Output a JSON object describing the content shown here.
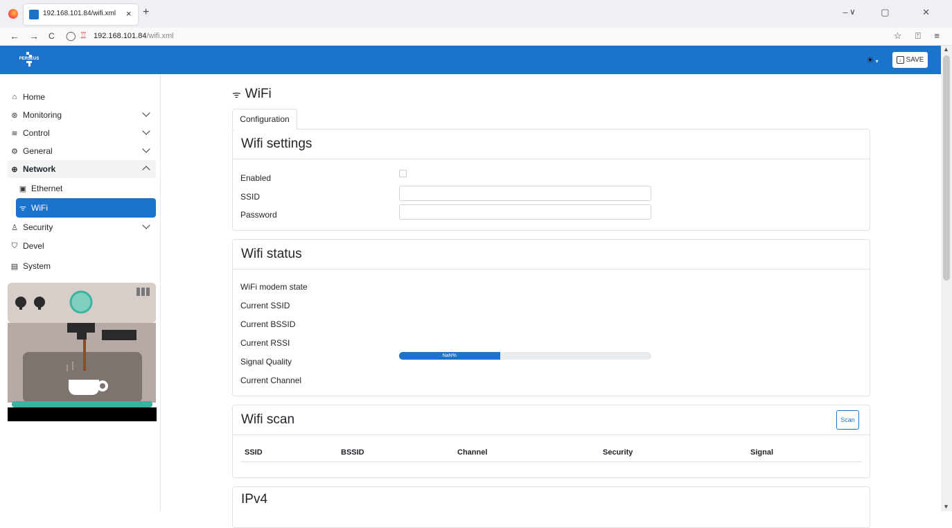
{
  "browser": {
    "tab_title": "192.168.101.84/wifi.xml",
    "tab_close": "×",
    "new_tab": "+",
    "url_host": "192.168.101.84",
    "url_path": "/wifi.xml",
    "back": "←",
    "forward": "→",
    "reload": "C",
    "tab_list": "∨",
    "window_controls": "– ▢ ✕",
    "toolbar_icons": "☆ ⍐ ≡"
  },
  "header": {
    "logo_text": "PERSEUS",
    "theme_icon": "☀",
    "save_label": "SAVE",
    "save_icon": "↓"
  },
  "sidebar": {
    "items": [
      {
        "label": "Home",
        "icon": "⌂"
      },
      {
        "label": "Monitoring",
        "icon": "⊛"
      },
      {
        "label": "Control",
        "icon": "≋"
      },
      {
        "label": "General",
        "icon": "⚙"
      },
      {
        "label": "Network",
        "icon": "⊕"
      },
      {
        "label": "Ethernet",
        "icon": "▣"
      },
      {
        "label": "WiFi",
        "icon": "ᯤ"
      },
      {
        "label": "Security",
        "icon": "♙"
      },
      {
        "label": "Devel",
        "icon": "⛉"
      },
      {
        "label": "System",
        "icon": "▤"
      }
    ]
  },
  "main": {
    "title": "WiFi",
    "title_icon": "ᯤ",
    "tabs": [
      {
        "label": "Configuration",
        "active": true
      }
    ],
    "wifi_settings": {
      "title": "Wifi settings",
      "enabled_label": "Enabled",
      "ssid_label": "SSID",
      "password_label": "Password",
      "ssid_value": "",
      "password_value": ""
    },
    "wifi_status": {
      "title": "Wifi status",
      "fields": [
        "WiFi modem state",
        "Current SSID",
        "Current BSSID",
        "Current RSSI",
        "Signal Quality",
        "Current Channel"
      ],
      "signal_text": "NaN%",
      "signal_fill_fraction": 0.4
    },
    "wifi_scan": {
      "title": "Wifi scan",
      "scan_label": "Scan",
      "columns": [
        "SSID",
        "BSSID",
        "Channel",
        "Security",
        "Signal"
      ]
    },
    "ipv4": {
      "title": "IPv4"
    }
  },
  "colors": {
    "accent": "#1c73cc"
  }
}
